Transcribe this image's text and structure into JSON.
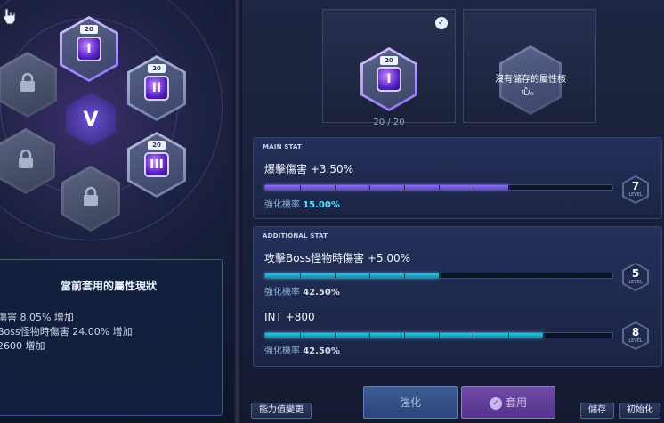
{
  "left": {
    "cores": [
      {
        "level": "20",
        "glyph": "I",
        "state": "selected"
      },
      {
        "level": "20",
        "glyph": "II",
        "state": "equipped"
      },
      {
        "level": "20",
        "glyph": "III",
        "state": "equipped"
      }
    ],
    "emblem": "V",
    "status": {
      "title": "當前套用的屬性現狀",
      "lines": [
        "傷害 8.05% 增加",
        "Boss怪物時傷害 24.00% 增加",
        "2600 增加"
      ]
    }
  },
  "right": {
    "selected_core": {
      "level": "20",
      "glyph": "I",
      "count": "20 / 20"
    },
    "empty_slot_text": "沒有儲存的屬性核心。",
    "main_stat": {
      "header": "MAIN STAT",
      "name": "爆擊傷害 +3.50%",
      "rate_label": "強化機率",
      "rate_value": "15.00%",
      "level": "7",
      "level_label": "LEVEL",
      "progress": 0.7,
      "bar_color": "#8a6cff"
    },
    "additional_stat": {
      "header": "ADDITIONAL STAT",
      "rows": [
        {
          "name": "攻擊Boss怪物時傷害 +5.00%",
          "rate_label": "強化機率",
          "rate_value": "42.50%",
          "level": "5",
          "level_label": "LEVEL",
          "progress": 0.5
        },
        {
          "name": "INT +800",
          "rate_label": "強化機率",
          "rate_value": "42.50%",
          "level": "8",
          "level_label": "LEVEL",
          "progress": 0.8
        }
      ],
      "bar_color": "#27c6e6"
    },
    "buttons": {
      "change_stats": "能力值變更",
      "enhance": "強化",
      "apply": "套用",
      "save": "儲存",
      "initialize": "初始化"
    }
  },
  "colors": {
    "accent_purple": "#8a6cff",
    "accent_cyan": "#27c6e6"
  }
}
